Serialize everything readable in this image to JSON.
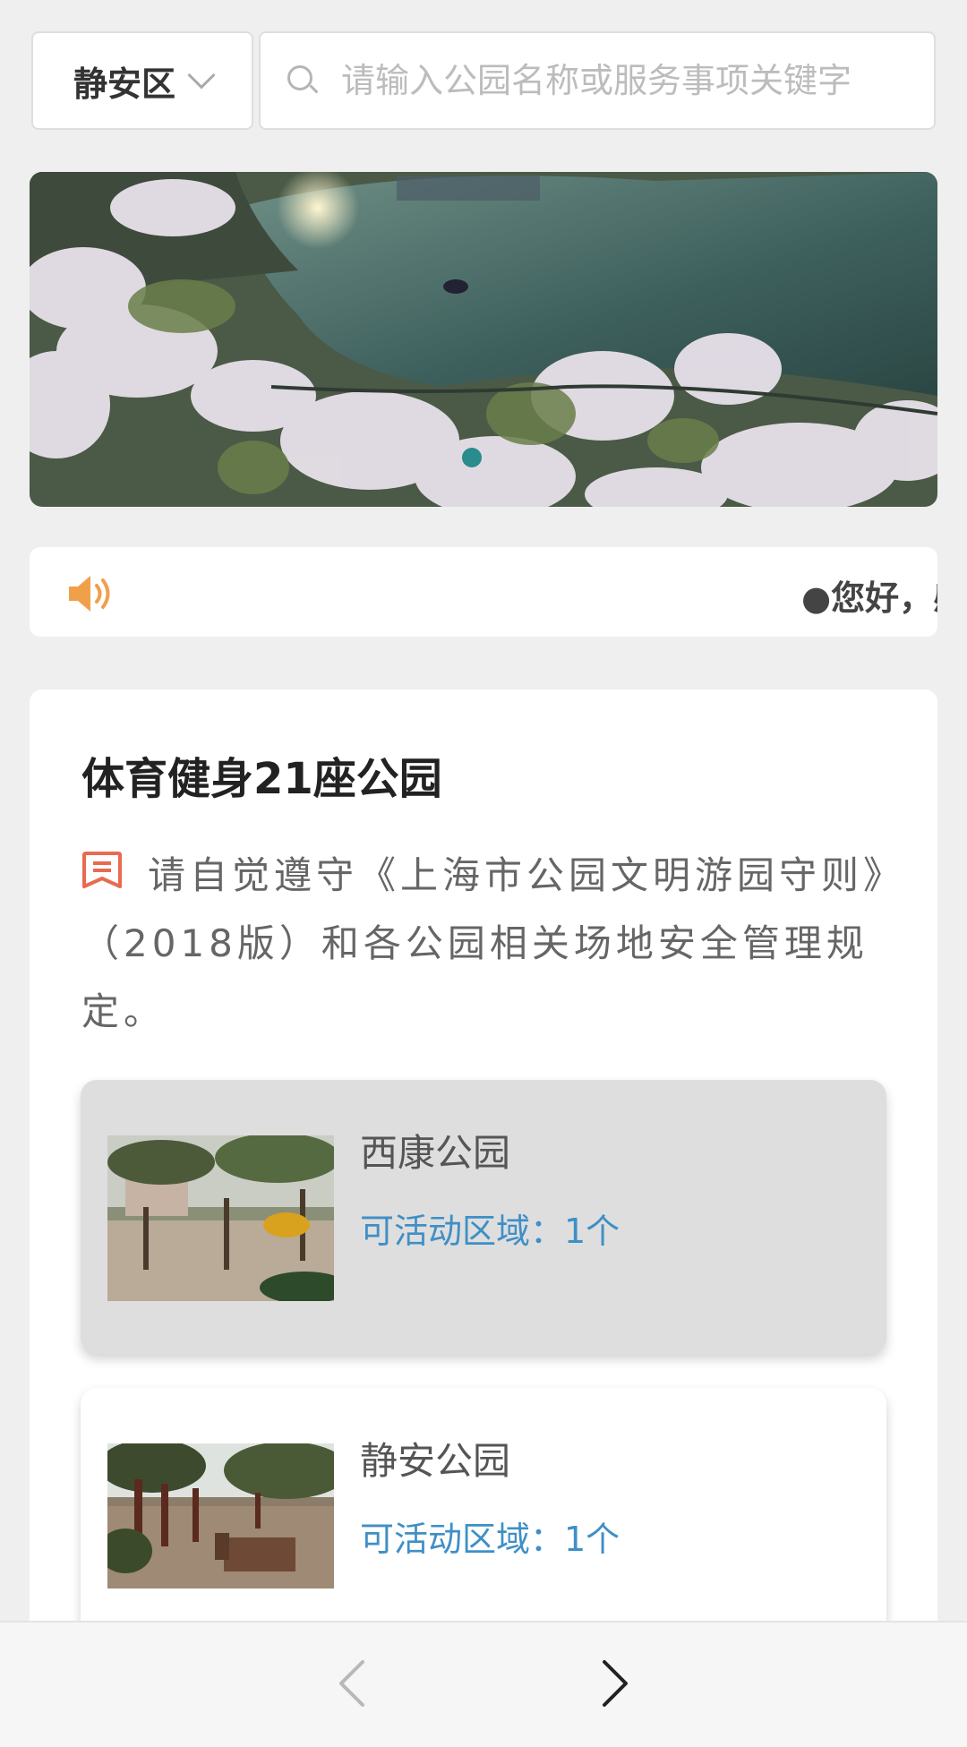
{
  "search_bar": {
    "district": "静安区",
    "placeholder": "请输入公园名称或服务事项关键字"
  },
  "notice": {
    "text": "●您好，感"
  },
  "section": {
    "title": "体育健身21座公园",
    "rules_text": "请自觉遵守《上海市公园文明游园守则》（2018版）和各公园相关场地安全管理规定。"
  },
  "parks": [
    {
      "name": "西康公园",
      "area": "可活动区域：1个",
      "highlighted": true
    },
    {
      "name": "静安公园",
      "area": "可活动区域：1个",
      "highlighted": false
    }
  ],
  "colors": {
    "accent_orange": "#f0a04b",
    "rules_icon": "#e86b4f",
    "link_blue": "#3f8fc6",
    "banner_dot": "#2a8c8c"
  },
  "icons": {
    "district_dropdown": "chevron-down-icon",
    "search": "search-icon",
    "notice": "speaker-icon",
    "rules": "bookmark-icon",
    "prev": "chevron-left-icon",
    "next": "chevron-right-icon"
  }
}
